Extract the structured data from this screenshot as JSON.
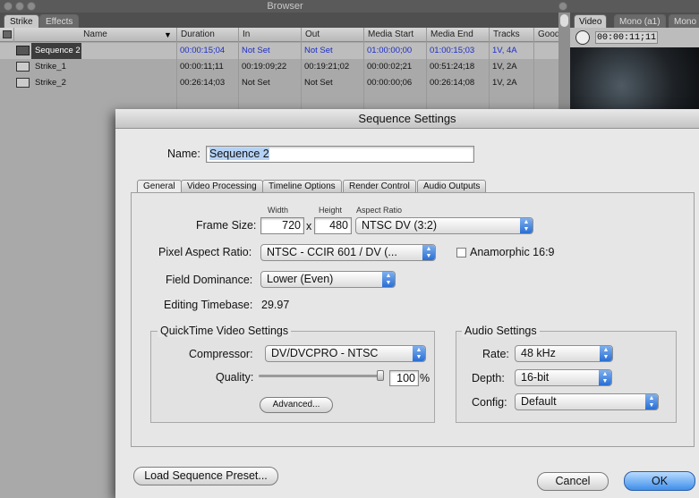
{
  "browser": {
    "title": "Browser",
    "tabs": [
      "Strike",
      "Effects"
    ],
    "columns": [
      "Name",
      "Duration",
      "In",
      "Out",
      "Media Start",
      "Media End",
      "Tracks",
      "Good"
    ],
    "rows": [
      {
        "name": "Sequence 2",
        "duration": "00:00:15;04",
        "in": "Not Set",
        "out": "Not Set",
        "media_start": "01:00:00;00",
        "media_end": "01:00:15;03",
        "tracks": "1V, 4A",
        "selected": true
      },
      {
        "name": "Strike_1",
        "duration": "00:00:11;11",
        "in": "00:19:09;22",
        "out": "00:19:21;02",
        "media_start": "00:00:02;21",
        "media_end": "00:51:24;18",
        "tracks": "1V, 2A",
        "selected": false
      },
      {
        "name": "Strike_2",
        "duration": "00:26:14;03",
        "in": "Not Set",
        "out": "Not Set",
        "media_start": "00:00:00;06",
        "media_end": "00:26:14;08",
        "tracks": "1V, 2A",
        "selected": false
      }
    ]
  },
  "viewer": {
    "tabs": [
      "Video",
      "Mono (a1)",
      "Mono"
    ],
    "timecode": "00:00:11;11"
  },
  "dialog": {
    "title": "Sequence Settings",
    "name_label": "Name:",
    "name_value": "Sequence 2",
    "tabs": [
      "General",
      "Video Processing",
      "Timeline Options",
      "Render Control",
      "Audio Outputs"
    ],
    "frame_size_label": "Frame Size:",
    "width_label": "Width",
    "height_label": "Height",
    "aspect_ratio_label": "Aspect Ratio",
    "width_value": "720",
    "x_sep": "x",
    "height_value": "480",
    "aspect_ratio_value": "NTSC DV (3:2)",
    "pixel_aspect_label": "Pixel Aspect Ratio:",
    "pixel_aspect_value": "NTSC - CCIR 601 / DV (...",
    "anamorphic_label": "Anamorphic 16:9",
    "field_dominance_label": "Field Dominance:",
    "field_dominance_value": "Lower (Even)",
    "editing_timebase_label": "Editing Timebase:",
    "editing_timebase_value": "29.97",
    "qt_group_title": "QuickTime Video Settings",
    "compressor_label": "Compressor:",
    "compressor_value": "DV/DVCPRO - NTSC",
    "quality_label": "Quality:",
    "quality_value": "100",
    "quality_unit": "%",
    "quality_level": 1.0,
    "advanced_button": "Advanced...",
    "audio_group_title": "Audio Settings",
    "rate_label": "Rate:",
    "rate_value": "48 kHz",
    "depth_label": "Depth:",
    "depth_value": "16-bit",
    "config_label": "Config:",
    "config_value": "Default",
    "load_preset_button": "Load Sequence Preset...",
    "cancel_button": "Cancel",
    "ok_button": "OK"
  },
  "colors": {
    "accent": "#2a6ed4",
    "selected_row": "#3d3d3d",
    "link_blue": "#1d2ec9"
  }
}
